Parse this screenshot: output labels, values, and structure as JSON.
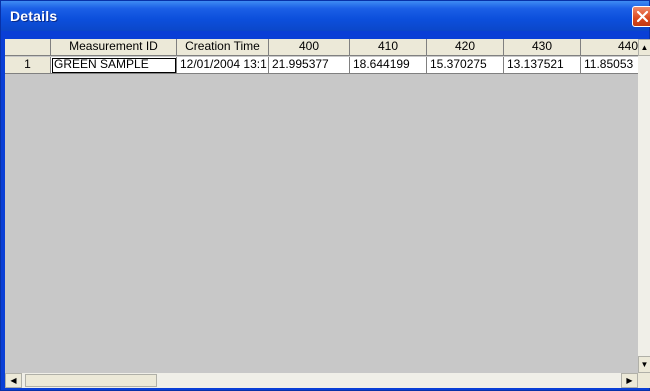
{
  "window": {
    "title": "Details"
  },
  "table": {
    "columns": [
      "",
      "Measurement ID",
      "Creation Time",
      "400",
      "410",
      "420",
      "430",
      "440"
    ],
    "rows": [
      {
        "row_number": "1",
        "measurement_id": "GREEN SAMPLE",
        "creation_time": "12/01/2004 13:1",
        "v400": "21.995377",
        "v410": "18.644199",
        "v420": "15.370275",
        "v430": "13.137521",
        "v440": "11.85053"
      }
    ]
  },
  "icons": {
    "close": "close-icon",
    "scroll_up": "arrow-up-icon",
    "scroll_down": "arrow-down-icon",
    "scroll_left": "arrow-left-icon",
    "scroll_right": "arrow-right-icon"
  },
  "colors": {
    "titlebar": "#0c4fdc",
    "close_button": "#d9481e",
    "grid_background": "#c8c8c8",
    "header_background": "#ece9d8"
  }
}
